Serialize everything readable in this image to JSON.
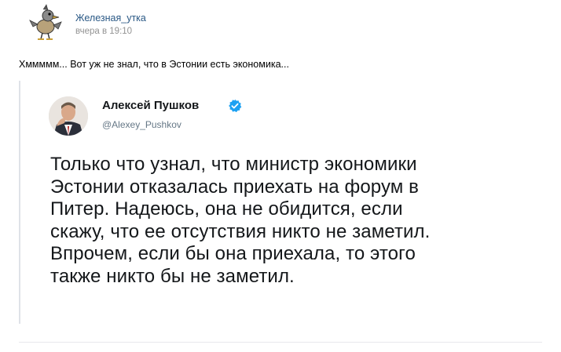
{
  "post": {
    "author": "Железная_утка",
    "time": "вчера в 19:10",
    "text": "Хммммм... Вот уж не знал, что в Эстонии есть экономика..."
  },
  "tweet": {
    "name": "Алексей Пушков",
    "handle": "@Alexey_Pushkov",
    "lines": [
      "Только что узнал, что министр экономики",
      "Эстонии отказалась приехать на форум в",
      "Питер. Надеюсь, она не обидится, если",
      "скажу, что ее отсутствия никто не заметил.",
      "Впрочем, если бы она приехала, то этого",
      "также никто бы не заметил."
    ]
  },
  "colors": {
    "link": "#2a5885",
    "verified": "#1da1f2"
  },
  "icons": {
    "author_avatar": "duck-avatar-icon",
    "tweet_avatar": "person-photo-avatar",
    "verified": "verified-badge-icon"
  }
}
